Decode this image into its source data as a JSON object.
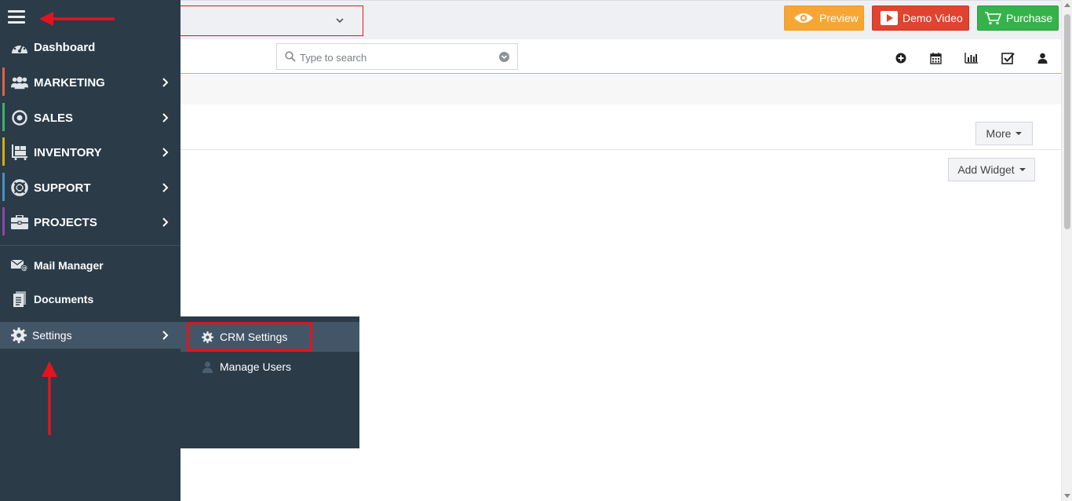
{
  "topbar": {
    "buttons": {
      "preview": "Preview",
      "demo_video": "Demo Video",
      "purchase": "Purchase"
    },
    "colors": {
      "preview": "#f7a635",
      "demo_video": "#e0432f",
      "purchase": "#35b34a"
    }
  },
  "search": {
    "placeholder": "Type to search",
    "icon": "search-icon"
  },
  "toolbar": {
    "icons": [
      "plus-circle-icon",
      "calendar-icon",
      "bar-chart-icon",
      "checkbox-icon",
      "user-icon"
    ]
  },
  "dashboard": {
    "more_label": "More",
    "add_widget_label": "Add Widget"
  },
  "sidebar": {
    "bg_color": "#2b3b48",
    "items": [
      {
        "label": "Dashboard",
        "icon": "dashboard-icon"
      },
      {
        "label": "MARKETING",
        "icon": "users-icon",
        "accent": "#e2633c"
      },
      {
        "label": "SALES",
        "icon": "target-icon",
        "accent": "#3cb371"
      },
      {
        "label": "INVENTORY",
        "icon": "boxes-icon",
        "accent": "#d4b106"
      },
      {
        "label": "SUPPORT",
        "icon": "lifebuoy-icon",
        "accent": "#4a90c8"
      },
      {
        "label": "PROJECTS",
        "icon": "briefcase-icon",
        "accent": "#8e44ad"
      },
      {
        "label": "Mail Manager",
        "icon": "mail-icon"
      },
      {
        "label": "Documents",
        "icon": "document-icon"
      },
      {
        "label": "Settings",
        "icon": "gear-icon"
      }
    ]
  },
  "submenu": {
    "items": [
      {
        "label": "CRM Settings",
        "icon": "gear-icon"
      },
      {
        "label": "Manage Users",
        "icon": "user-icon"
      }
    ]
  },
  "annotation_color": "#e3141e"
}
